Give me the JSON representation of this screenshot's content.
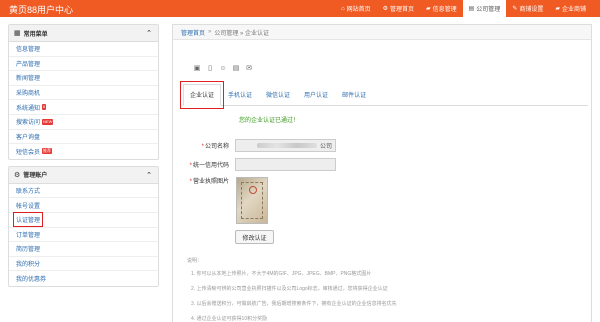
{
  "topbar": {
    "brand": "黄页88用户中心",
    "nav": [
      {
        "icon": "home-icon",
        "glyph": "⌂",
        "label": "网站首页",
        "active": false
      },
      {
        "icon": "gear-icon",
        "glyph": "⚙",
        "label": "管理首页",
        "active": false
      },
      {
        "icon": "folder-icon",
        "glyph": "▰",
        "label": "信息管理",
        "active": false
      },
      {
        "icon": "building-icon",
        "glyph": "▤",
        "label": "公司管理",
        "active": true
      },
      {
        "icon": "wrench-icon",
        "glyph": "✎",
        "label": "商铺设置",
        "active": false
      },
      {
        "icon": "shop-icon",
        "glyph": "▰",
        "label": "企业商铺",
        "active": false
      }
    ]
  },
  "sidebar": {
    "common": {
      "title": "常用菜单",
      "items": [
        {
          "label": "信息管理",
          "badge": ""
        },
        {
          "label": "产品管理",
          "badge": ""
        },
        {
          "label": "新闻管理",
          "badge": ""
        },
        {
          "label": "采购商机",
          "badge": ""
        },
        {
          "label": "系统通知",
          "badge": "6"
        },
        {
          "label": "搜索访问",
          "badge": "NEW"
        },
        {
          "label": "客户询盘",
          "badge": ""
        },
        {
          "label": "短信会员",
          "badge": "推荐"
        }
      ]
    },
    "account": {
      "title": "管理账户",
      "items": [
        {
          "label": "联系方式",
          "highlight": false
        },
        {
          "label": "帐号设置",
          "highlight": false
        },
        {
          "label": "认证管理",
          "highlight": true
        },
        {
          "label": "订单管理",
          "highlight": false
        },
        {
          "label": "简历管理",
          "highlight": false
        },
        {
          "label": "我的积分",
          "highlight": false
        },
        {
          "label": "我的优惠券",
          "highlight": false
        }
      ]
    }
  },
  "breadcrumb": {
    "home": "管理首页",
    "separator": "»",
    "rest": "公司管理 » 企业认证"
  },
  "tabs": [
    "企业认证",
    "手机认证",
    "微信认证",
    "用户认证",
    "邮件认证"
  ],
  "verified_text": "您的企业认证已通过！",
  "form": {
    "company_label": "公司名称",
    "company_suffix": "公司",
    "credit_label": "统一信用代码",
    "credit_value": "",
    "license_label": "营业执照图片",
    "modify_button": "修改认证"
  },
  "notes": {
    "heading": "说明：",
    "lines": [
      "1. 你可以从本地上传照片，不大于4M的GIF、JPG、JPEG、BMP、PNG格式图片",
      "2. 上传清晰可辨的公司营业执照扫描件以及公司Logo标志，审核通过，您将获得企业认证",
      "3. 以后会赠送积分，可做启航广告，我后期增搜索条件下，拥有企业认证的企业信息排名优先",
      "4. 通过企业认证可获得10积分奖励"
    ]
  }
}
